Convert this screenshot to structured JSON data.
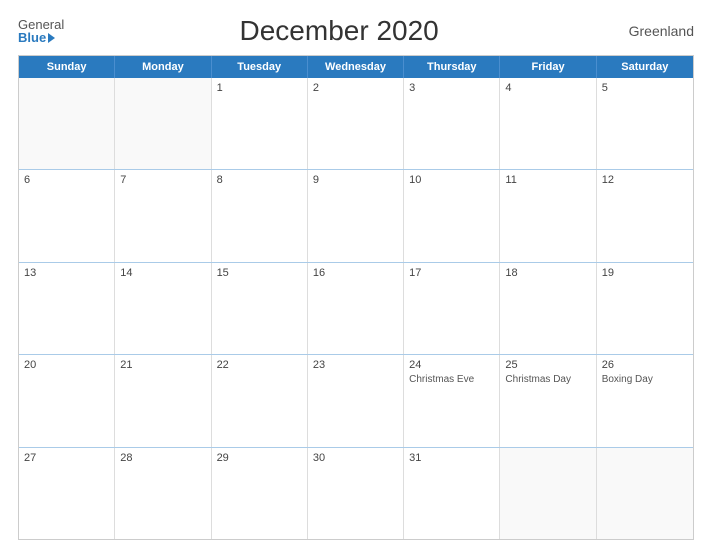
{
  "header": {
    "logo_general": "General",
    "logo_blue": "Blue",
    "title": "December 2020",
    "region": "Greenland"
  },
  "calendar": {
    "days_of_week": [
      "Sunday",
      "Monday",
      "Tuesday",
      "Wednesday",
      "Thursday",
      "Friday",
      "Saturday"
    ],
    "weeks": [
      [
        {
          "day": "",
          "empty": true
        },
        {
          "day": "",
          "empty": true
        },
        {
          "day": "1",
          "empty": false,
          "event": ""
        },
        {
          "day": "2",
          "empty": false,
          "event": ""
        },
        {
          "day": "3",
          "empty": false,
          "event": ""
        },
        {
          "day": "4",
          "empty": false,
          "event": ""
        },
        {
          "day": "5",
          "empty": false,
          "event": ""
        }
      ],
      [
        {
          "day": "6",
          "empty": false,
          "event": ""
        },
        {
          "day": "7",
          "empty": false,
          "event": ""
        },
        {
          "day": "8",
          "empty": false,
          "event": ""
        },
        {
          "day": "9",
          "empty": false,
          "event": ""
        },
        {
          "day": "10",
          "empty": false,
          "event": ""
        },
        {
          "day": "11",
          "empty": false,
          "event": ""
        },
        {
          "day": "12",
          "empty": false,
          "event": ""
        }
      ],
      [
        {
          "day": "13",
          "empty": false,
          "event": ""
        },
        {
          "day": "14",
          "empty": false,
          "event": ""
        },
        {
          "day": "15",
          "empty": false,
          "event": ""
        },
        {
          "day": "16",
          "empty": false,
          "event": ""
        },
        {
          "day": "17",
          "empty": false,
          "event": ""
        },
        {
          "day": "18",
          "empty": false,
          "event": ""
        },
        {
          "day": "19",
          "empty": false,
          "event": ""
        }
      ],
      [
        {
          "day": "20",
          "empty": false,
          "event": ""
        },
        {
          "day": "21",
          "empty": false,
          "event": ""
        },
        {
          "day": "22",
          "empty": false,
          "event": ""
        },
        {
          "day": "23",
          "empty": false,
          "event": ""
        },
        {
          "day": "24",
          "empty": false,
          "event": "Christmas Eve"
        },
        {
          "day": "25",
          "empty": false,
          "event": "Christmas Day"
        },
        {
          "day": "26",
          "empty": false,
          "event": "Boxing Day"
        }
      ],
      [
        {
          "day": "27",
          "empty": false,
          "event": ""
        },
        {
          "day": "28",
          "empty": false,
          "event": ""
        },
        {
          "day": "29",
          "empty": false,
          "event": ""
        },
        {
          "day": "30",
          "empty": false,
          "event": ""
        },
        {
          "day": "31",
          "empty": false,
          "event": ""
        },
        {
          "day": "",
          "empty": true
        },
        {
          "day": "",
          "empty": true
        }
      ]
    ]
  }
}
